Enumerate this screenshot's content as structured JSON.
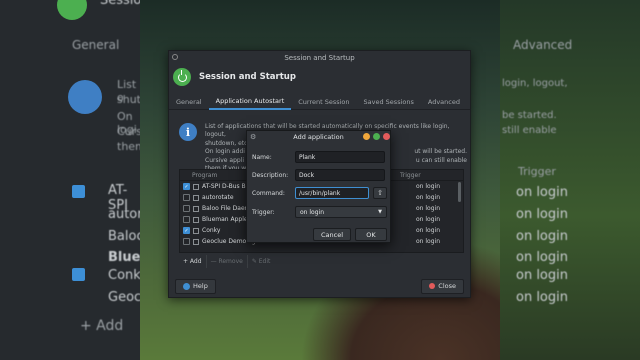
{
  "background": {
    "ghost_left": {
      "title": "Sessio",
      "tab": "General",
      "line1": "List o",
      "line2": "shutd",
      "line3": "On logi",
      "line4": "Cursi",
      "line5": "them",
      "rows": [
        "AT-SPI",
        "autoro",
        "Baloo",
        "Bluem",
        "Conky",
        "Geoclu"
      ],
      "add": "+ Add"
    },
    "ghost_right": {
      "tab": "Advanced",
      "line1": "login, logout,",
      "line2": "be started.",
      "line3": "still enable",
      "trigger_head": "Trigger",
      "triggers": [
        "on login",
        "on login",
        "on login",
        "on login",
        "on login",
        "on login"
      ]
    }
  },
  "window": {
    "title": "Session and Startup",
    "header_title": "Session and Startup",
    "tabs": [
      "General",
      "Application Autostart",
      "Current Session",
      "Saved Sessions",
      "Advanced"
    ],
    "active_tab": 1,
    "info_line1": "List of applications that will be started automatically on specific events like login, logout,",
    "info_line2": "shutdown, etc.",
    "info_line3_a": "On login addi",
    "info_line3_b": "ut will be started.",
    "info_line4_a": "Cursive appli",
    "info_line4_b": "u can still enable",
    "info_line5": "them if you w",
    "columns": {
      "program": "Program",
      "trigger": "Trigger"
    },
    "rows": [
      {
        "name": "AT-SPI D-Bus Bu",
        "checked": true,
        "trigger": "on login"
      },
      {
        "name": "autorotate",
        "checked": false,
        "trigger": "on login"
      },
      {
        "name": "Baloo File Daem",
        "checked": false,
        "trigger": "on login"
      },
      {
        "name": "Blueman Apple",
        "checked": false,
        "trigger": "on login"
      },
      {
        "name": "Conky",
        "checked": true,
        "trigger": "on login"
      },
      {
        "name": "Geoclue Demo agent",
        "checked": false,
        "trigger": "on login"
      }
    ],
    "toolbar": {
      "add": "+ Add",
      "remove": "— Remove",
      "edit": "✎ Edit"
    },
    "help": "Help",
    "close": "Close"
  },
  "dialog": {
    "title": "Add application",
    "name_label": "Name:",
    "name_value": "Plank",
    "description_label": "Description:",
    "description_value": "Dock",
    "command_label": "Command:",
    "command_value": "/usr/bin/plank",
    "trigger_label": "Trigger:",
    "trigger_value": "on login",
    "cancel": "Cancel",
    "ok": "OK"
  },
  "colors": {
    "accent": "#3f8fd2",
    "green": "#4caf50",
    "close_red": "#e35b5b",
    "window_bg": "#2b2e33"
  }
}
